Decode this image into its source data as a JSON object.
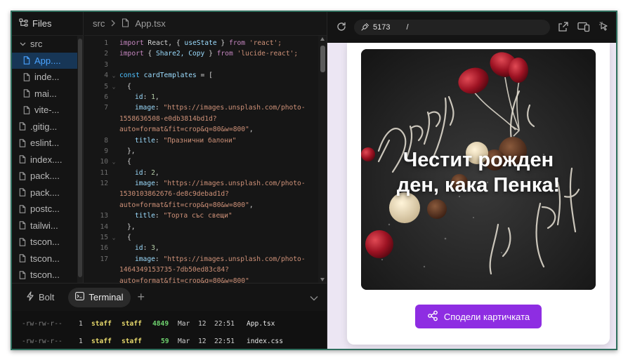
{
  "explorer": {
    "title": "Files",
    "items": [
      {
        "label": "src",
        "type": "folder",
        "depth": 0,
        "active": false
      },
      {
        "label": "App....",
        "type": "file",
        "depth": 1,
        "active": true
      },
      {
        "label": "inde...",
        "type": "file",
        "depth": 1,
        "active": false
      },
      {
        "label": "mai...",
        "type": "file",
        "depth": 1,
        "active": false
      },
      {
        "label": "vite-...",
        "type": "file",
        "depth": 1,
        "active": false
      },
      {
        "label": ".gitig...",
        "type": "file",
        "depth": 0,
        "active": false
      },
      {
        "label": "eslint...",
        "type": "file",
        "depth": 0,
        "active": false
      },
      {
        "label": "index....",
        "type": "file",
        "depth": 0,
        "active": false
      },
      {
        "label": "pack....",
        "type": "file",
        "depth": 0,
        "active": false
      },
      {
        "label": "pack....",
        "type": "file",
        "depth": 0,
        "active": false
      },
      {
        "label": "postc...",
        "type": "file",
        "depth": 0,
        "active": false
      },
      {
        "label": "tailwi...",
        "type": "file",
        "depth": 0,
        "active": false
      },
      {
        "label": "tscon...",
        "type": "file",
        "depth": 0,
        "active": false
      },
      {
        "label": "tscon...",
        "type": "file",
        "depth": 0,
        "active": false
      },
      {
        "label": "tscon...",
        "type": "file",
        "depth": 0,
        "active": false
      }
    ]
  },
  "editor": {
    "breadcrumb": {
      "folder": "src",
      "file": "App.tsx"
    },
    "code": {
      "l1": {
        "n": "1",
        "a": "import",
        "b": " React, { ",
        "c": "useState",
        "d": " } ",
        "e": "from",
        "f": " 'react';"
      },
      "l2": {
        "n": "2",
        "a": "import",
        "b": " { ",
        "c": "Share2, Copy",
        "d": " } ",
        "e": "from",
        "f": " 'lucide-react';"
      },
      "l3": {
        "n": "3"
      },
      "l4": {
        "n": "4",
        "a": "const",
        "b": " cardTemplates",
        "c": " = ["
      },
      "l5": {
        "n": "5",
        "a": "{"
      },
      "l6": {
        "n": "6",
        "a": "id",
        "b": ": ",
        "c": "1",
        "d": ","
      },
      "l7": {
        "n": "7",
        "a": "image",
        "b": ": ",
        "c": "\"https://images.unsplash.com/photo-",
        "d": "1558636508-e0db3814bd1d?",
        "e": "auto=format&fit=crop&q=80&w=800\"",
        "f": ","
      },
      "l8": {
        "n": "8",
        "a": "title",
        "b": ": ",
        "c": "\"Празнични балони\""
      },
      "l9": {
        "n": "9",
        "a": "},"
      },
      "l10": {
        "n": "10",
        "a": "{"
      },
      "l11": {
        "n": "11",
        "a": "id",
        "b": ": ",
        "c": "2",
        "d": ","
      },
      "l12": {
        "n": "12",
        "a": "image",
        "b": ": ",
        "c": "\"https://images.unsplash.com/photo-",
        "d": "1530103862676-de8c9debad1d?",
        "e": "auto=format&fit=crop&q=80&w=800\"",
        "f": ","
      },
      "l13": {
        "n": "13",
        "a": "title",
        "b": ": ",
        "c": "\"Торта със свещи\""
      },
      "l14": {
        "n": "14",
        "a": "},"
      },
      "l15": {
        "n": "15",
        "a": "{"
      },
      "l16": {
        "n": "16",
        "a": "id",
        "b": ": ",
        "c": "3",
        "d": ","
      },
      "l17": {
        "n": "17",
        "a": "image",
        "b": ": ",
        "c": "\"https://images.unsplash.com/photo-",
        "d": "1464349153735-7db50ed83c84?",
        "e": "auto=format&fit=crop&q=80&w=800\""
      }
    }
  },
  "panel": {
    "tabs": [
      {
        "label": "Bolt",
        "icon": "bolt-icon",
        "active": false
      },
      {
        "label": "Terminal",
        "icon": "terminal-icon",
        "active": true
      }
    ]
  },
  "terminal": {
    "rows": [
      {
        "perm": "-rw-rw-r--",
        "links": "1",
        "user": "staff",
        "group": "staff",
        "size": "4849",
        "month": "Mar",
        "day": "12",
        "time": "22:51",
        "name": "App.tsx"
      },
      {
        "perm": "-rw-rw-r--",
        "links": "1",
        "user": "staff",
        "group": "staff",
        "size": "59",
        "month": "Mar",
        "day": "12",
        "time": "22:51",
        "name": "index.css"
      }
    ]
  },
  "preview": {
    "port": "5173",
    "path": "/",
    "card": {
      "greeting_line1": "Честит рожден",
      "greeting_line2": "ден, кака Пенка!",
      "share_label": "Сподели картичката"
    }
  },
  "colors": {
    "accent": "#8e2de2",
    "active_file_bg": "#173656",
    "active_file_text": "#4aa3ff",
    "frame_border": "#2f6f5e"
  }
}
